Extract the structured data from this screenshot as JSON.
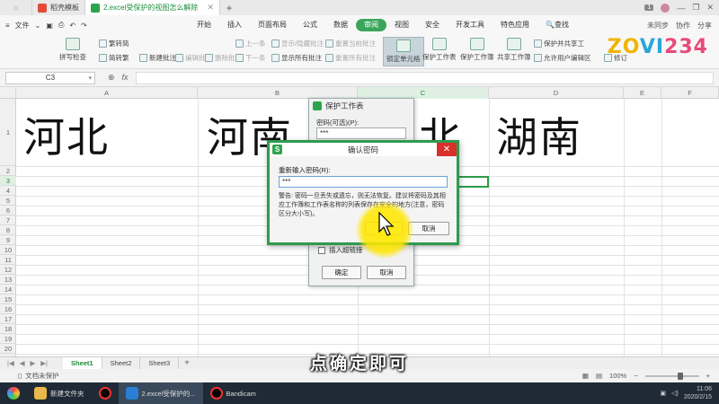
{
  "titlebar": {
    "tabs": [
      {
        "label": "稻壳模板",
        "color": "#e14b3a"
      },
      {
        "label": "2.excel受保护的视图怎么解除",
        "color": "#2ea34d"
      }
    ],
    "badge": "1"
  },
  "menubar": {
    "file_label": "文件",
    "items": [
      "开始",
      "插入",
      "页面布局",
      "公式",
      "数据",
      "审阅",
      "视图",
      "安全",
      "开发工具",
      "特色应用"
    ],
    "active_item": "审阅",
    "search_label": "查找",
    "sync_label": "未同步",
    "share_label": "协作",
    "share2_label": "分享"
  },
  "ribbon": {
    "spell_check": "拼写检查",
    "trad_to_simp": "繁转简",
    "simp_to_trad": "简转繁",
    "new_comment": "新建批注",
    "edit_comment": "编辑批注",
    "delete_comment": "删除批注",
    "prev": "上一条",
    "next": "下一条",
    "show_hide_comment": "显示/隐藏批注",
    "show_all_comments": "显示所有批注",
    "reset_current_comment": "重置当前批注",
    "reset_all_comments": "重置所有批注",
    "lock_cell": "锁定单元格",
    "protect_sheet": "保护工作表",
    "protect_workbook": "保护工作簿",
    "share_workbook": "共享工作簿",
    "protect_and_share": "保护并共享工",
    "allow_users_edit": "允许用户编辑区",
    "revise": "修订"
  },
  "logo": {
    "part1": "ZO",
    "part2": "VI",
    "part3": "234"
  },
  "formula_bar": {
    "cell_ref": "C3",
    "fx_label": "fx"
  },
  "grid": {
    "columns": [
      "A",
      "B",
      "C",
      "D",
      "E",
      "F"
    ],
    "selected_column": "C",
    "rows": [
      "1",
      "2",
      "3",
      "4",
      "5",
      "6",
      "7",
      "8",
      "9",
      "10",
      "11",
      "12",
      "13",
      "14",
      "15",
      "16",
      "17",
      "18",
      "19",
      "20"
    ],
    "selected_row": "3",
    "cells": {
      "A1": "河北",
      "B1": "河南",
      "C1": "北",
      "D1": "湖南"
    }
  },
  "sheet_tabs": [
    "Sheet1",
    "Sheet2",
    "Sheet3"
  ],
  "active_sheet": "Sheet1",
  "status": {
    "doc_status": "文档未保护",
    "zoom": "100%"
  },
  "protect_dialog": {
    "title": "保护工作表",
    "password_label": "密码(可选)(P):",
    "password_value": "***",
    "option_hyperlink": "插入超链接",
    "ok": "确定",
    "cancel": "取消"
  },
  "confirm_dialog": {
    "title": "确认密码",
    "reenter_label": "重新输入密码(R):",
    "password_value": "***",
    "warning": "警告: 密码一旦丢失或遗忘，则无法恢复。建议将密码及其相应工作簿和工作表名称的列表保存在安全的地方(注意，密码区分大小写)。",
    "ok": "确定",
    "cancel": "取消"
  },
  "taskbar": {
    "items": [
      "新建文件夹",
      "2.excel受保护的...",
      "Bandicam"
    ],
    "time": "11:06",
    "date": "2020/2/15"
  },
  "subtitle": "点确定即可"
}
